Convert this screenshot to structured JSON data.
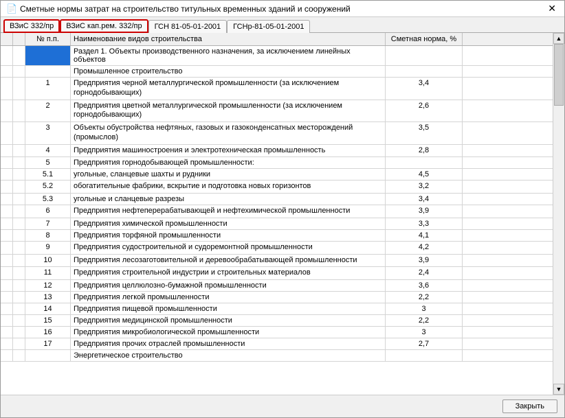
{
  "window": {
    "title": "Сметные нормы затрат на строительство титульных временных зданий и сооружений",
    "close": "✕"
  },
  "tabs": [
    {
      "label": "ВЗиС 332/пр",
      "hl": true
    },
    {
      "label": "ВЗиС кап.рем. 332/пр",
      "hl": true
    },
    {
      "label": "ГСН 81-05-01-2001",
      "hl": false
    },
    {
      "label": "ГСНр-81-05-01-2001",
      "hl": false
    }
  ],
  "grid": {
    "columns": {
      "num": "№ п.п.",
      "name": "Наименование видов строительства",
      "norm": "Сметная норма, %"
    },
    "rows": [
      {
        "num": "",
        "name": "Раздел 1. Объекты производственного назначения, за исключением линейных объектов",
        "norm": "",
        "section": true,
        "selected": true
      },
      {
        "num": "",
        "name": "Промышленное строительство",
        "norm": "",
        "section": true
      },
      {
        "num": "1",
        "name": "Предприятия черной металлургической промышленности (за исключением горнодобывающих)",
        "norm": "3,4"
      },
      {
        "num": "2",
        "name": "Предприятия цветной металлургической промышленности (за исключением горнодобывающих)",
        "norm": "2,6"
      },
      {
        "num": "3",
        "name": "Объекты обустройства нефтяных, газовых и газоконденсатных месторождений (промыслов)",
        "norm": "3,5"
      },
      {
        "num": "4",
        "name": "Предприятия машиностроения и электротехническая промышленность",
        "norm": "2,8"
      },
      {
        "num": "5",
        "name": "Предприятия горнодобывающей промышленности:",
        "norm": ""
      },
      {
        "num": "5.1",
        "name": "угольные, сланцевые шахты и рудники",
        "norm": "4,5",
        "sub": true
      },
      {
        "num": "5.2",
        "name": "обогатительные фабрики, вскрытие и подготовка новых горизонтов",
        "norm": "3,2",
        "sub": true
      },
      {
        "num": "5.3",
        "name": "угольные и сланцевые разрезы",
        "norm": "3,4",
        "sub": true
      },
      {
        "num": "6",
        "name": "Предприятия нефтеперерабатывающей и нефтехимической промышленности",
        "norm": "3,9"
      },
      {
        "num": "7",
        "name": "Предприятия химической промышленности",
        "norm": "3,3"
      },
      {
        "num": "8",
        "name": "Предприятия торфяной промышленности",
        "norm": "4,1"
      },
      {
        "num": "9",
        "name": "Предприятия судостроительной и судоремонтной промышленности",
        "norm": "4,2"
      },
      {
        "num": "10",
        "name": "Предприятия лесозаготовительной и деревообрабатывающей промышленности",
        "norm": "3,9"
      },
      {
        "num": "11",
        "name": "Предприятия строительной индустрии и строительных материалов",
        "norm": "2,4"
      },
      {
        "num": "12",
        "name": "Предприятия целлюлозно-бумажной промышленности",
        "norm": "3,6"
      },
      {
        "num": "13",
        "name": "Предприятия легкой промышленности",
        "norm": "2,2"
      },
      {
        "num": "14",
        "name": "Предприятия пищевой промышленности",
        "norm": "3"
      },
      {
        "num": "15",
        "name": "Предприятия медицинской промышленности",
        "norm": "2,2"
      },
      {
        "num": "16",
        "name": "Предприятия микробиологической промышленности",
        "norm": "3"
      },
      {
        "num": "17",
        "name": "Предприятия прочих отраслей промышленности",
        "norm": "2,7"
      },
      {
        "num": "",
        "name": "Энергетическое строительство",
        "norm": "",
        "section": true
      }
    ]
  },
  "footer": {
    "close": "Закрыть"
  }
}
